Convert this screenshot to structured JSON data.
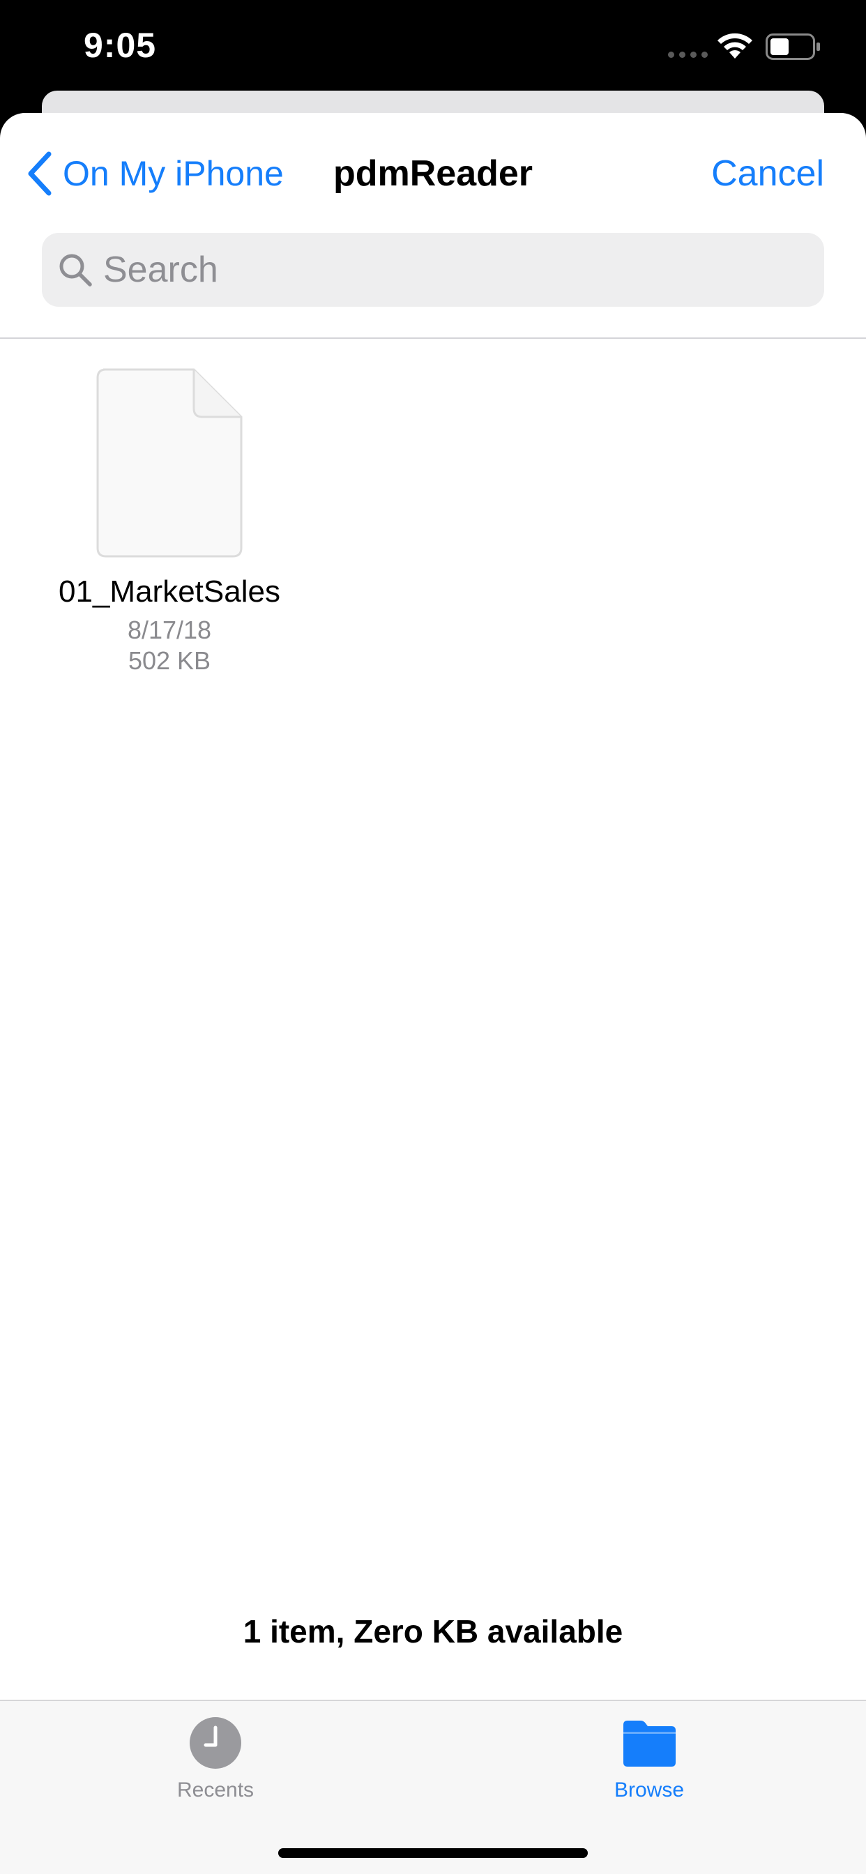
{
  "status_bar": {
    "time": "9:05"
  },
  "nav": {
    "back_label": "On My iPhone",
    "title": "pdmReader",
    "cancel_label": "Cancel"
  },
  "search": {
    "placeholder": "Search",
    "value": ""
  },
  "files": [
    {
      "name": "01_MarketSales",
      "date": "8/17/18",
      "size": "502 KB",
      "icon": "document-icon"
    }
  ],
  "footer": {
    "status": "1 item, Zero KB available"
  },
  "tabs": [
    {
      "label": "Recents",
      "icon": "clock-icon",
      "selected": false
    },
    {
      "label": "Browse",
      "icon": "folder-icon",
      "selected": true
    }
  ],
  "colors": {
    "accent": "#157efb",
    "inactive_tab": "#8e8e93",
    "recents_icon": "#9a9a9e"
  }
}
